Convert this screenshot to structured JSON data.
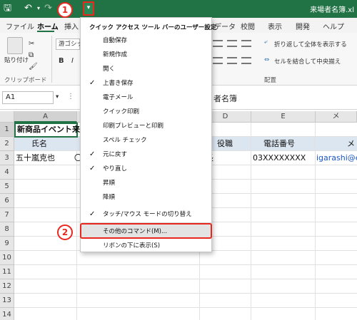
{
  "title_bar": {
    "file_title": "来場者名簿.xl",
    "icons": [
      "save-icon",
      "undo-icon",
      "redo-icon",
      "customize-toolbar-icon"
    ]
  },
  "ribbon_tabs": [
    "ファイル",
    "ホーム",
    "挿入",
    "データ",
    "校閲",
    "表示",
    "開発",
    "ヘルプ"
  ],
  "ribbon": {
    "paste_label": "貼り付け",
    "clipboard_group": "クリップボード",
    "font_name": "游ゴシック",
    "wrap_text": "折り返して全体を表示する",
    "merge_center": "セルを結合して中央揃え",
    "alignment_group": "配置",
    "bold": "B",
    "italic": "I"
  },
  "formula_bar": {
    "name_box": "A1",
    "content": "者名簿"
  },
  "columns": [
    "A",
    "D",
    "E",
    "メ"
  ],
  "rows": [
    "1",
    "2",
    "3",
    "4",
    "5",
    "6",
    "7",
    "8",
    "9",
    "10",
    "11",
    "12",
    "13",
    "14"
  ],
  "cells": {
    "a1": "新商品イベント来場",
    "a2": "氏名",
    "a3": "五十嵐克也",
    "b3": "〇",
    "c3": "長",
    "d2": "役職",
    "e2": "電話番号",
    "e3": "03XXXXXXXX",
    "f2": "メ",
    "f3": "igarashi@exa"
  },
  "menu": {
    "title": "クイック アクセス ツール バーのユーザー設定",
    "items": [
      {
        "label": "自動保存",
        "checked": false
      },
      {
        "label": "新規作成",
        "checked": false
      },
      {
        "label": "開く",
        "checked": false
      },
      {
        "label": "上書き保存",
        "checked": true
      },
      {
        "label": "電子メール",
        "checked": false
      },
      {
        "label": "クイック印刷",
        "checked": false
      },
      {
        "label": "印刷プレビューと印刷",
        "checked": false
      },
      {
        "label": "スペル チェック",
        "checked": false
      },
      {
        "label": "元に戻す",
        "checked": true
      },
      {
        "label": "やり直し",
        "checked": true
      },
      {
        "label": "昇順",
        "checked": false
      },
      {
        "label": "降順",
        "checked": false
      },
      {
        "label": "タッチ/マウス モードの切り替え",
        "checked": true
      },
      {
        "label": "その他のコマンド(M)...",
        "checked": false
      },
      {
        "label": "リボンの下に表示(S)",
        "checked": false
      }
    ],
    "check_mark": "✓"
  },
  "callouts": {
    "one": "1",
    "two": "2"
  },
  "colors": {
    "excel_green": "#217346",
    "highlight_red": "#e8281f",
    "header_fill": "#dce6f1"
  }
}
